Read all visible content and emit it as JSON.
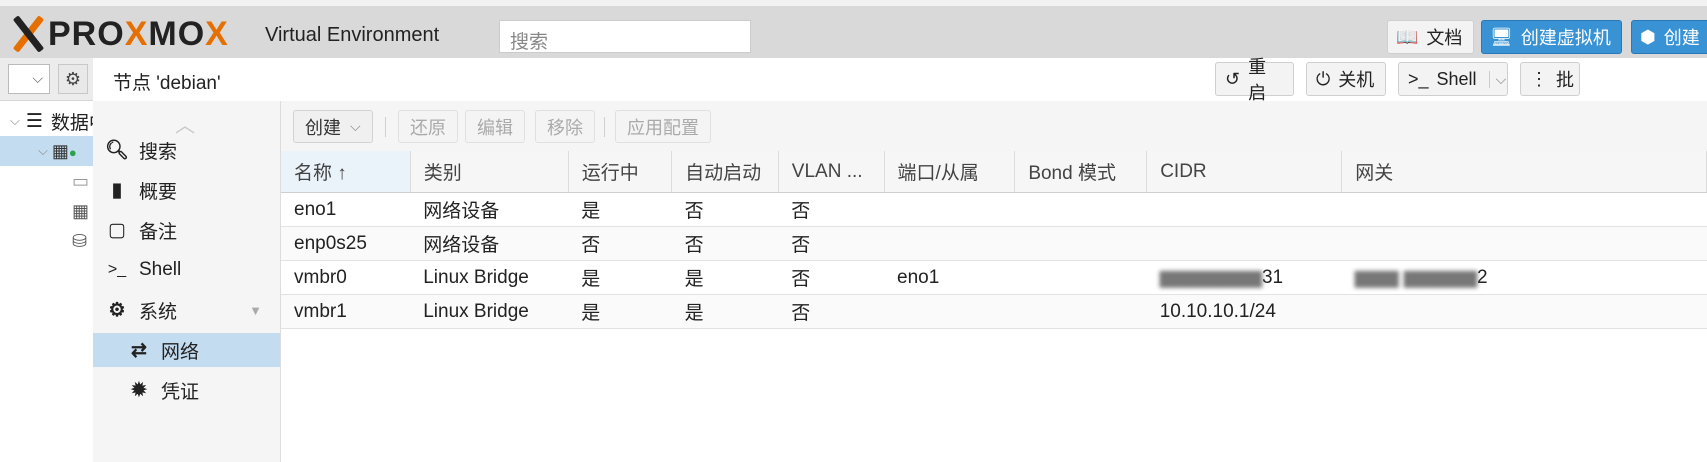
{
  "header": {
    "logo_text": "PROXMOX",
    "product": "Virtual Environment",
    "search_placeholder": "搜索",
    "docs_label": "文档",
    "create_vm_label": "创建虚拟机",
    "create_ct_label": "创建"
  },
  "tree": {
    "items": [
      {
        "label": "数据中心"
      }
    ]
  },
  "node_header": {
    "title": "节点 'debian'",
    "reboot_label": "重启",
    "shutdown_label": "关机",
    "shell_label": "Shell",
    "bulk_label": "批"
  },
  "menu": {
    "items": [
      {
        "label": "搜索",
        "icon": "search-icon"
      },
      {
        "label": "概要",
        "icon": "book-icon"
      },
      {
        "label": "备注",
        "icon": "note-icon"
      },
      {
        "label": "Shell",
        "icon": "terminal-icon"
      },
      {
        "label": "系统",
        "icon": "gears-icon"
      },
      {
        "label": "网络",
        "icon": "exchange-icon"
      },
      {
        "label": "凭证",
        "icon": "certificate-icon"
      }
    ]
  },
  "toolbar": {
    "create": "创建",
    "revert": "还原",
    "edit": "编辑",
    "remove": "移除",
    "apply": "应用配置"
  },
  "table": {
    "columns": [
      "名称 ↑",
      "类别",
      "运行中",
      "自动启动",
      "VLAN ...",
      "端口/从属",
      "Bond 模式",
      "CIDR",
      "网关"
    ],
    "rows": [
      [
        "eno1",
        "网络设备",
        "是",
        "否",
        "否",
        "",
        "",
        "",
        ""
      ],
      [
        "enp0s25",
        "网络设备",
        "否",
        "否",
        "否",
        "",
        "",
        "",
        ""
      ],
      [
        "vmbr0",
        "Linux Bridge",
        "是",
        "是",
        "否",
        "eno1",
        "",
        "31",
        "2"
      ],
      [
        "vmbr1",
        "Linux Bridge",
        "是",
        "是",
        "否",
        "",
        "",
        "10.10.10.1/24",
        ""
      ]
    ]
  },
  "colors": {
    "accent": "#3892d4",
    "selection": "#c4dcf0",
    "brand_orange": "#e57000"
  }
}
